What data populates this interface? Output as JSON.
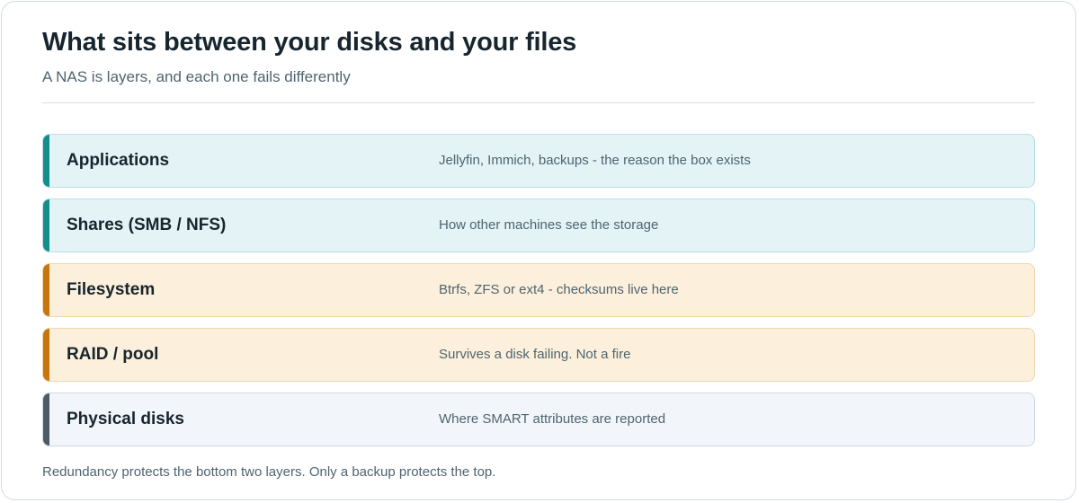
{
  "header": {
    "title": "What sits between your disks and your files",
    "subtitle": "A NAS is layers, and each one fails differently"
  },
  "layers": [
    {
      "name": "Applications",
      "description": "Jellyfin, Immich, backups - the reason the box exists",
      "accent": "#138e8e",
      "fill": "#e3f3f6"
    },
    {
      "name": "Shares (SMB / NFS)",
      "description": "How other machines see the storage",
      "accent": "#138e8e",
      "fill": "#e3f3f6"
    },
    {
      "name": "Filesystem",
      "description": "Btrfs, ZFS or ext4 - checksums live here",
      "accent": "#c8740f",
      "fill": "#fcf0dc"
    },
    {
      "name": "RAID / pool",
      "description": "Survives a disk failing. Not a fire",
      "accent": "#c8740f",
      "fill": "#fcf0dc"
    },
    {
      "name": "Physical disks",
      "description": "Where SMART attributes are reported",
      "accent": "#4d5b68",
      "fill": "#f2f6fa"
    }
  ],
  "footnote": "Redundancy protects the bottom two layers. Only a backup protects the top."
}
